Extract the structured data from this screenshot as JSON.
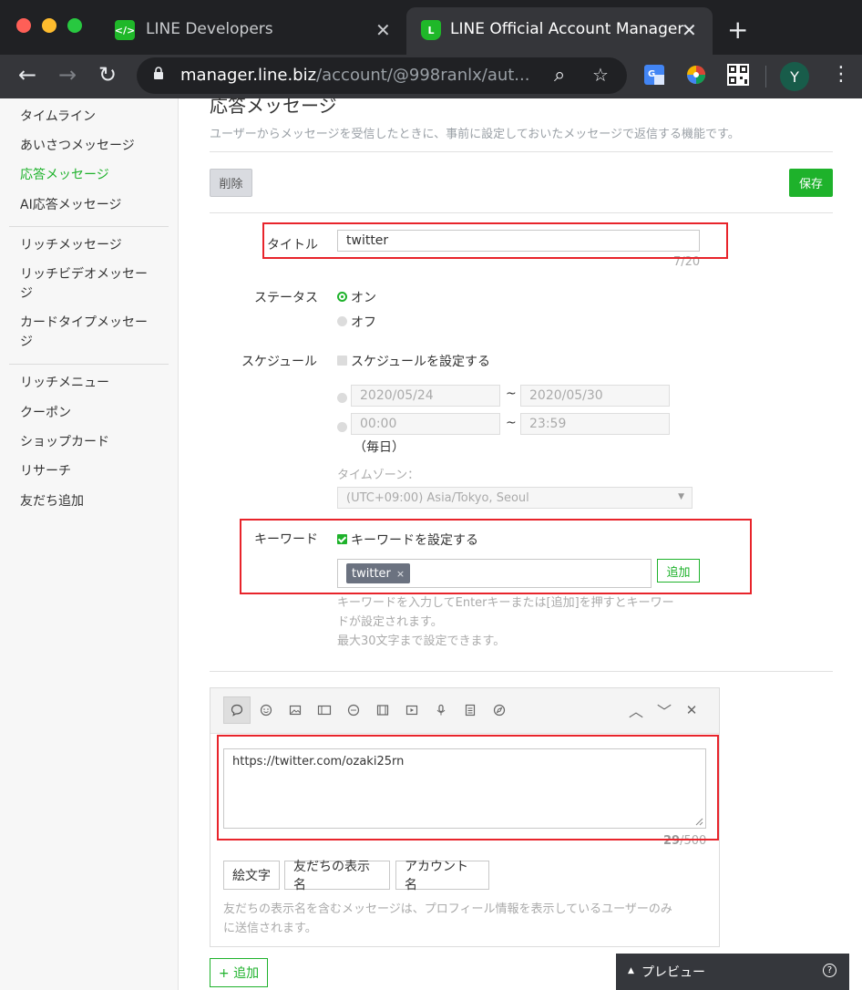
{
  "browser": {
    "tabs": [
      {
        "title": "LINE Developers",
        "icon": "code-icon",
        "favicon_text": "</>"
      },
      {
        "title": "LINE Official Account Manager",
        "icon": "line-icon",
        "favicon_text": "L"
      }
    ],
    "close_glyph": "✕",
    "new_tab_glyph": "+",
    "url_host": "manager.line.biz",
    "url_path": "/account/@998ranlx/aut...",
    "avatar_letter": "Y",
    "glyphs": {
      "back": "←",
      "forward": "→",
      "reload": "↻",
      "search": "⌕",
      "star": "☆",
      "menu": "⋮"
    }
  },
  "sidebar": {
    "groups": [
      [
        "タイムライン",
        "あいさつメッセージ",
        "応答メッセージ",
        "AI応答メッセージ"
      ],
      [
        "リッチメッセージ",
        "リッチビデオメッセージ",
        "カードタイプメッセージ"
      ],
      [
        "リッチメニュー",
        "クーポン",
        "ショップカード",
        "リサーチ",
        "友だち追加"
      ]
    ],
    "active": "応答メッセージ",
    "accent": "#1eb22b"
  },
  "page": {
    "title": "応答メッセージ",
    "subtitle": "ユーザーからメッセージを受信したときに、事前に設定しておいたメッセージで返信する機能です。",
    "delete_label": "削除",
    "save_label": "保存"
  },
  "form": {
    "title_label": "タイトル",
    "title_value": "twitter",
    "title_counter": "7/20",
    "status_label": "ステータス",
    "status_on": "オン",
    "status_off": "オフ",
    "status_selected": "オン",
    "schedule_label": "スケジュール",
    "schedule_checkbox": "スケジュールを設定する",
    "schedule_checked": false,
    "date_from": "2020/05/24",
    "date_to": "2020/05/30",
    "time_from": "00:00",
    "time_to": "23:59",
    "tilde": "~",
    "daily": "（毎日）",
    "timezone_label": "タイムゾーン：",
    "timezone_value": "(UTC+09:00) Asia/Tokyo, Seoul",
    "keyword_label": "キーワード",
    "keyword_checkbox": "キーワードを設定する",
    "keyword_checked": true,
    "keyword_tag": "twitter",
    "keyword_tag_remove": "×",
    "keyword_add": "追加",
    "keyword_help": [
      "キーワードを入力してEnterキーまたは[追加]を押すとキーワー",
      "ドが設定されます。",
      "最大30文字まで設定できます。"
    ]
  },
  "editor": {
    "tools": [
      "speech-bubble-icon",
      "emoji-icon",
      "image-icon",
      "card-icon",
      "coupon-icon",
      "video-frame-icon",
      "video-icon",
      "mic-icon",
      "document-icon",
      "compass-icon"
    ],
    "controls": [
      "chevron-up-icon",
      "chevron-down-icon",
      "close-icon"
    ],
    "message": "https://twitter.com/ozaki25rn",
    "counter_count": "29",
    "counter_max": "/500",
    "var_buttons": [
      "絵文字",
      "友だちの表示名",
      "アカウント名"
    ],
    "note": [
      "友だちの表示名を含むメッセージは、プロフィール情報を表示しているユーザーのみ",
      "に送信されます。"
    ]
  },
  "add_message": "+ 追加",
  "preview": {
    "label": "プレビュー",
    "help": "?"
  }
}
